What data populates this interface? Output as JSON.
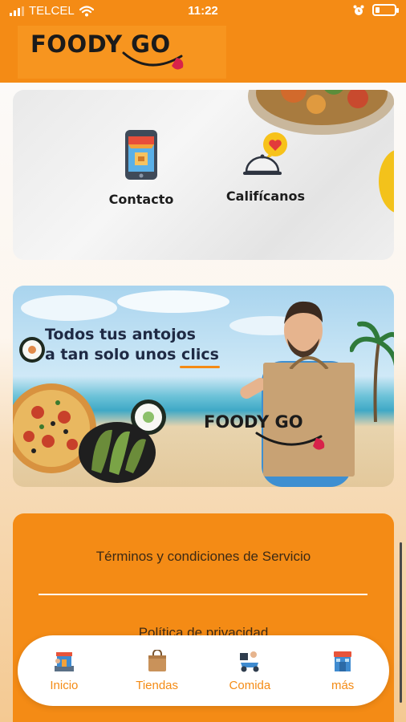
{
  "status_bar": {
    "carrier": "TELCEL",
    "time": "11:22",
    "icons": [
      "signal-icon",
      "wifi-icon",
      "alarm-icon",
      "battery-icon"
    ]
  },
  "header": {
    "logo_text": "FOODY GO",
    "background": "#f48b15"
  },
  "actions": [
    {
      "label": "Contacto",
      "icon": "phone-store-icon"
    },
    {
      "label": "Califícanos",
      "icon": "cloche-heart-icon"
    }
  ],
  "promo": {
    "line1": "Todos tus antojos",
    "line2": "a tan solo unos clics",
    "brand": "FOODY GO"
  },
  "footer_links": {
    "terms": "Términos y condiciones de Servicio",
    "privacy": "Política de privacidad"
  },
  "tabbar": {
    "items": [
      {
        "label": "Inicio",
        "icon": "home-shop-icon"
      },
      {
        "label": "Tiendas",
        "icon": "shopping-bag-icon"
      },
      {
        "label": "Comida",
        "icon": "delivery-scooter-icon"
      },
      {
        "label": "más",
        "icon": "store-more-icon"
      }
    ]
  },
  "colors": {
    "brand_orange": "#f48b15",
    "tab_label": "#f48b15"
  }
}
